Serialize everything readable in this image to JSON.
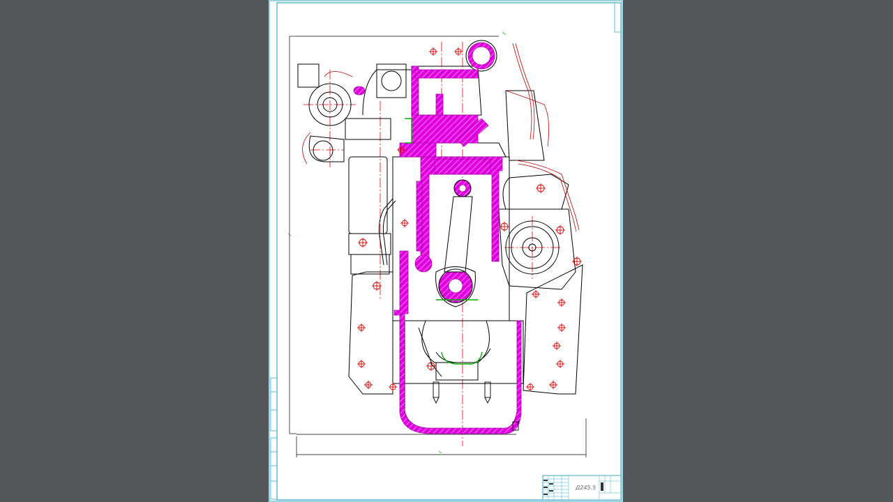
{
  "viewer": {
    "background_color": "#53575a",
    "sheet_color": "#ffffff"
  },
  "drawing": {
    "title_block": {
      "designation": "Д245.5"
    },
    "colors": {
      "frame": "#3aa9c9",
      "outline": "#000000",
      "section_fill": "#e000e0",
      "centerline": "#e00000",
      "gasket": "#00b000",
      "extension_line": "#00a000"
    }
  }
}
